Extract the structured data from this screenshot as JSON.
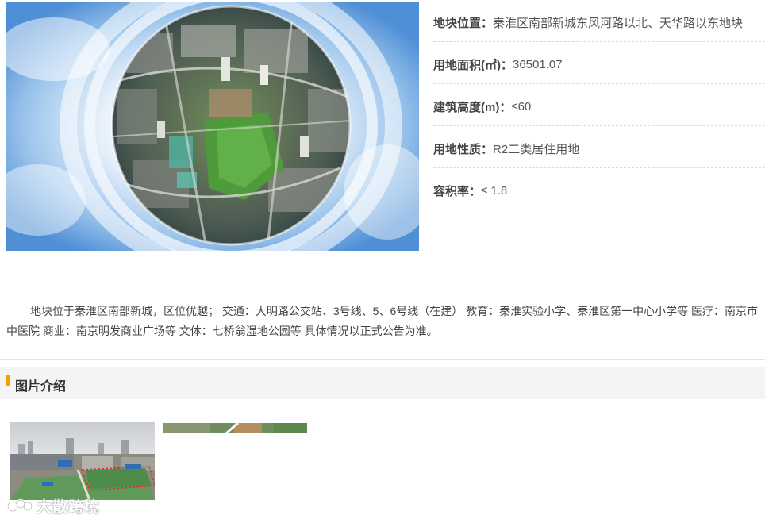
{
  "info": {
    "location_label": "地块位置：",
    "location_value": "秦淮区南部新城东风河路以北、天华路以东地块",
    "area_label": "用地面积(㎡)：",
    "area_value": "36501.07",
    "height_label": "建筑高度(m)：",
    "height_value": "≤60",
    "nature_label": "用地性质：",
    "nature_value": "R2二类居住用地",
    "far_label": "容积率：",
    "far_value": "≤ 1.8"
  },
  "description": "地块位于秦淮区南部新城，区位优越； 交通：大明路公交站、3号线、5、6号线（在建） 教育：秦淮实验小学、秦淮区第一中心小学等 医疗：南京市中医院 商业：南京明发商业广场等 文体：七桥翁湿地公园等 具体情况以正式公告为准。",
  "section": {
    "title": "图片介绍"
  },
  "watermark": {
    "text": "大散跨境"
  },
  "colors": {
    "accent": "#f2a100",
    "section_bg": "#f4f4f4",
    "divider": "#dcdcdc"
  }
}
